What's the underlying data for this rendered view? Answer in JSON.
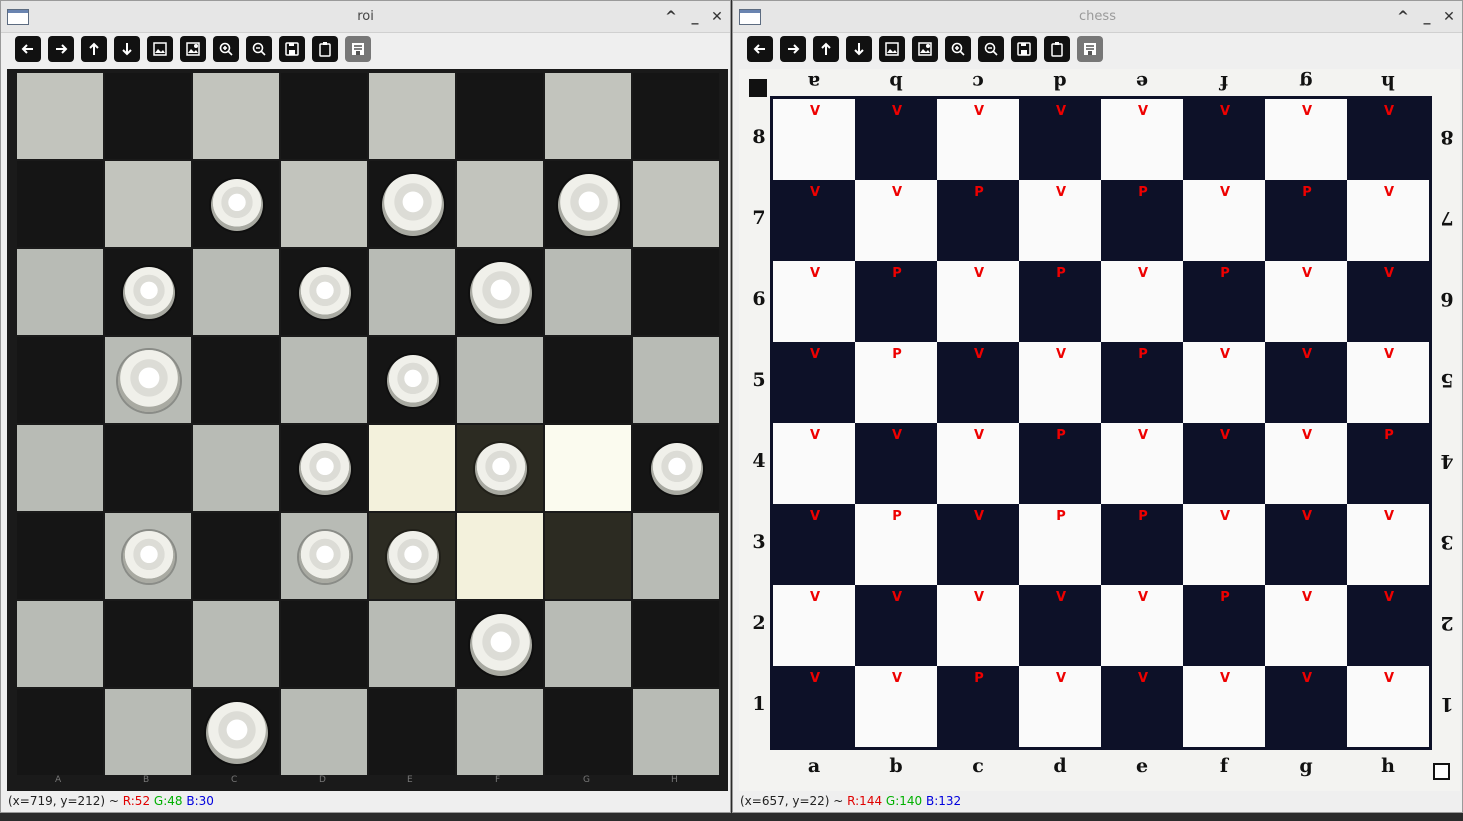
{
  "roi_window": {
    "title": "roi",
    "status": {
      "coords": "(x=719, y=212) ~ ",
      "r": "R:52",
      "g": "G:48",
      "b": "B:30"
    },
    "board_bottom_labels": [
      "a",
      "b",
      "c",
      "d",
      "e",
      "f",
      "g",
      "h"
    ]
  },
  "chess_window": {
    "title": "chess",
    "status": {
      "coords": "(x=657, y=22) ~ ",
      "r": "R:144",
      "g": "G:140",
      "b": "B:132"
    },
    "files_bottom": [
      "a",
      "b",
      "c",
      "d",
      "e",
      "f",
      "g",
      "h"
    ],
    "files_top": [
      "a",
      "b",
      "c",
      "d",
      "e",
      "f",
      "g",
      "h"
    ],
    "ranks": [
      "8",
      "7",
      "6",
      "5",
      "4",
      "3",
      "2",
      "1"
    ],
    "detections": [
      [
        "V",
        "V",
        "V",
        "V",
        "V",
        "V",
        "V",
        "V"
      ],
      [
        "V",
        "V",
        "P",
        "V",
        "P",
        "V",
        "P",
        "V"
      ],
      [
        "V",
        "P",
        "V",
        "P",
        "V",
        "P",
        "V",
        "V"
      ],
      [
        "V",
        "P",
        "V",
        "V",
        "P",
        "V",
        "V",
        "V"
      ],
      [
        "V",
        "V",
        "V",
        "P",
        "V",
        "V",
        "V",
        "P"
      ],
      [
        "V",
        "P",
        "V",
        "P",
        "P",
        "V",
        "V",
        "V"
      ],
      [
        "V",
        "V",
        "V",
        "V",
        "V",
        "P",
        "V",
        "V"
      ],
      [
        "V",
        "V",
        "P",
        "V",
        "V",
        "V",
        "V",
        "V"
      ]
    ]
  },
  "toolbar_icons": [
    "arrow-left-icon",
    "arrow-right-icon",
    "arrow-up-icon",
    "arrow-down-icon",
    "image-icon",
    "image-properties-icon",
    "zoom-in-icon",
    "zoom-out-icon",
    "save-icon",
    "clipboard-icon",
    "properties-icon"
  ],
  "roi_pieces": [
    {
      "row": 1,
      "col": 2,
      "kind": "pawn"
    },
    {
      "row": 1,
      "col": 4,
      "kind": "knight"
    },
    {
      "row": 1,
      "col": 6,
      "kind": "knight"
    },
    {
      "row": 2,
      "col": 1,
      "kind": "pawn"
    },
    {
      "row": 2,
      "col": 3,
      "kind": "pawn"
    },
    {
      "row": 2,
      "col": 5,
      "kind": "knight"
    },
    {
      "row": 3,
      "col": 1,
      "kind": "knight"
    },
    {
      "row": 3,
      "col": 4,
      "kind": "pawn"
    },
    {
      "row": 4,
      "col": 3,
      "kind": "pawn"
    },
    {
      "row": 4,
      "col": 5,
      "kind": "pawn"
    },
    {
      "row": 4,
      "col": 7,
      "kind": "pawn"
    },
    {
      "row": 5,
      "col": 1,
      "kind": "pawn"
    },
    {
      "row": 5,
      "col": 3,
      "kind": "pawn"
    },
    {
      "row": 5,
      "col": 4,
      "kind": "pawn"
    },
    {
      "row": 6,
      "col": 5,
      "kind": "knight"
    },
    {
      "row": 7,
      "col": 2,
      "kind": "knight"
    }
  ],
  "colors": {
    "mark": "#ee0000",
    "roi_dark": "#151515",
    "roi_light": "#b8bbb5",
    "chess_dark": "#0d1128",
    "chess_light": "#fafafa"
  }
}
